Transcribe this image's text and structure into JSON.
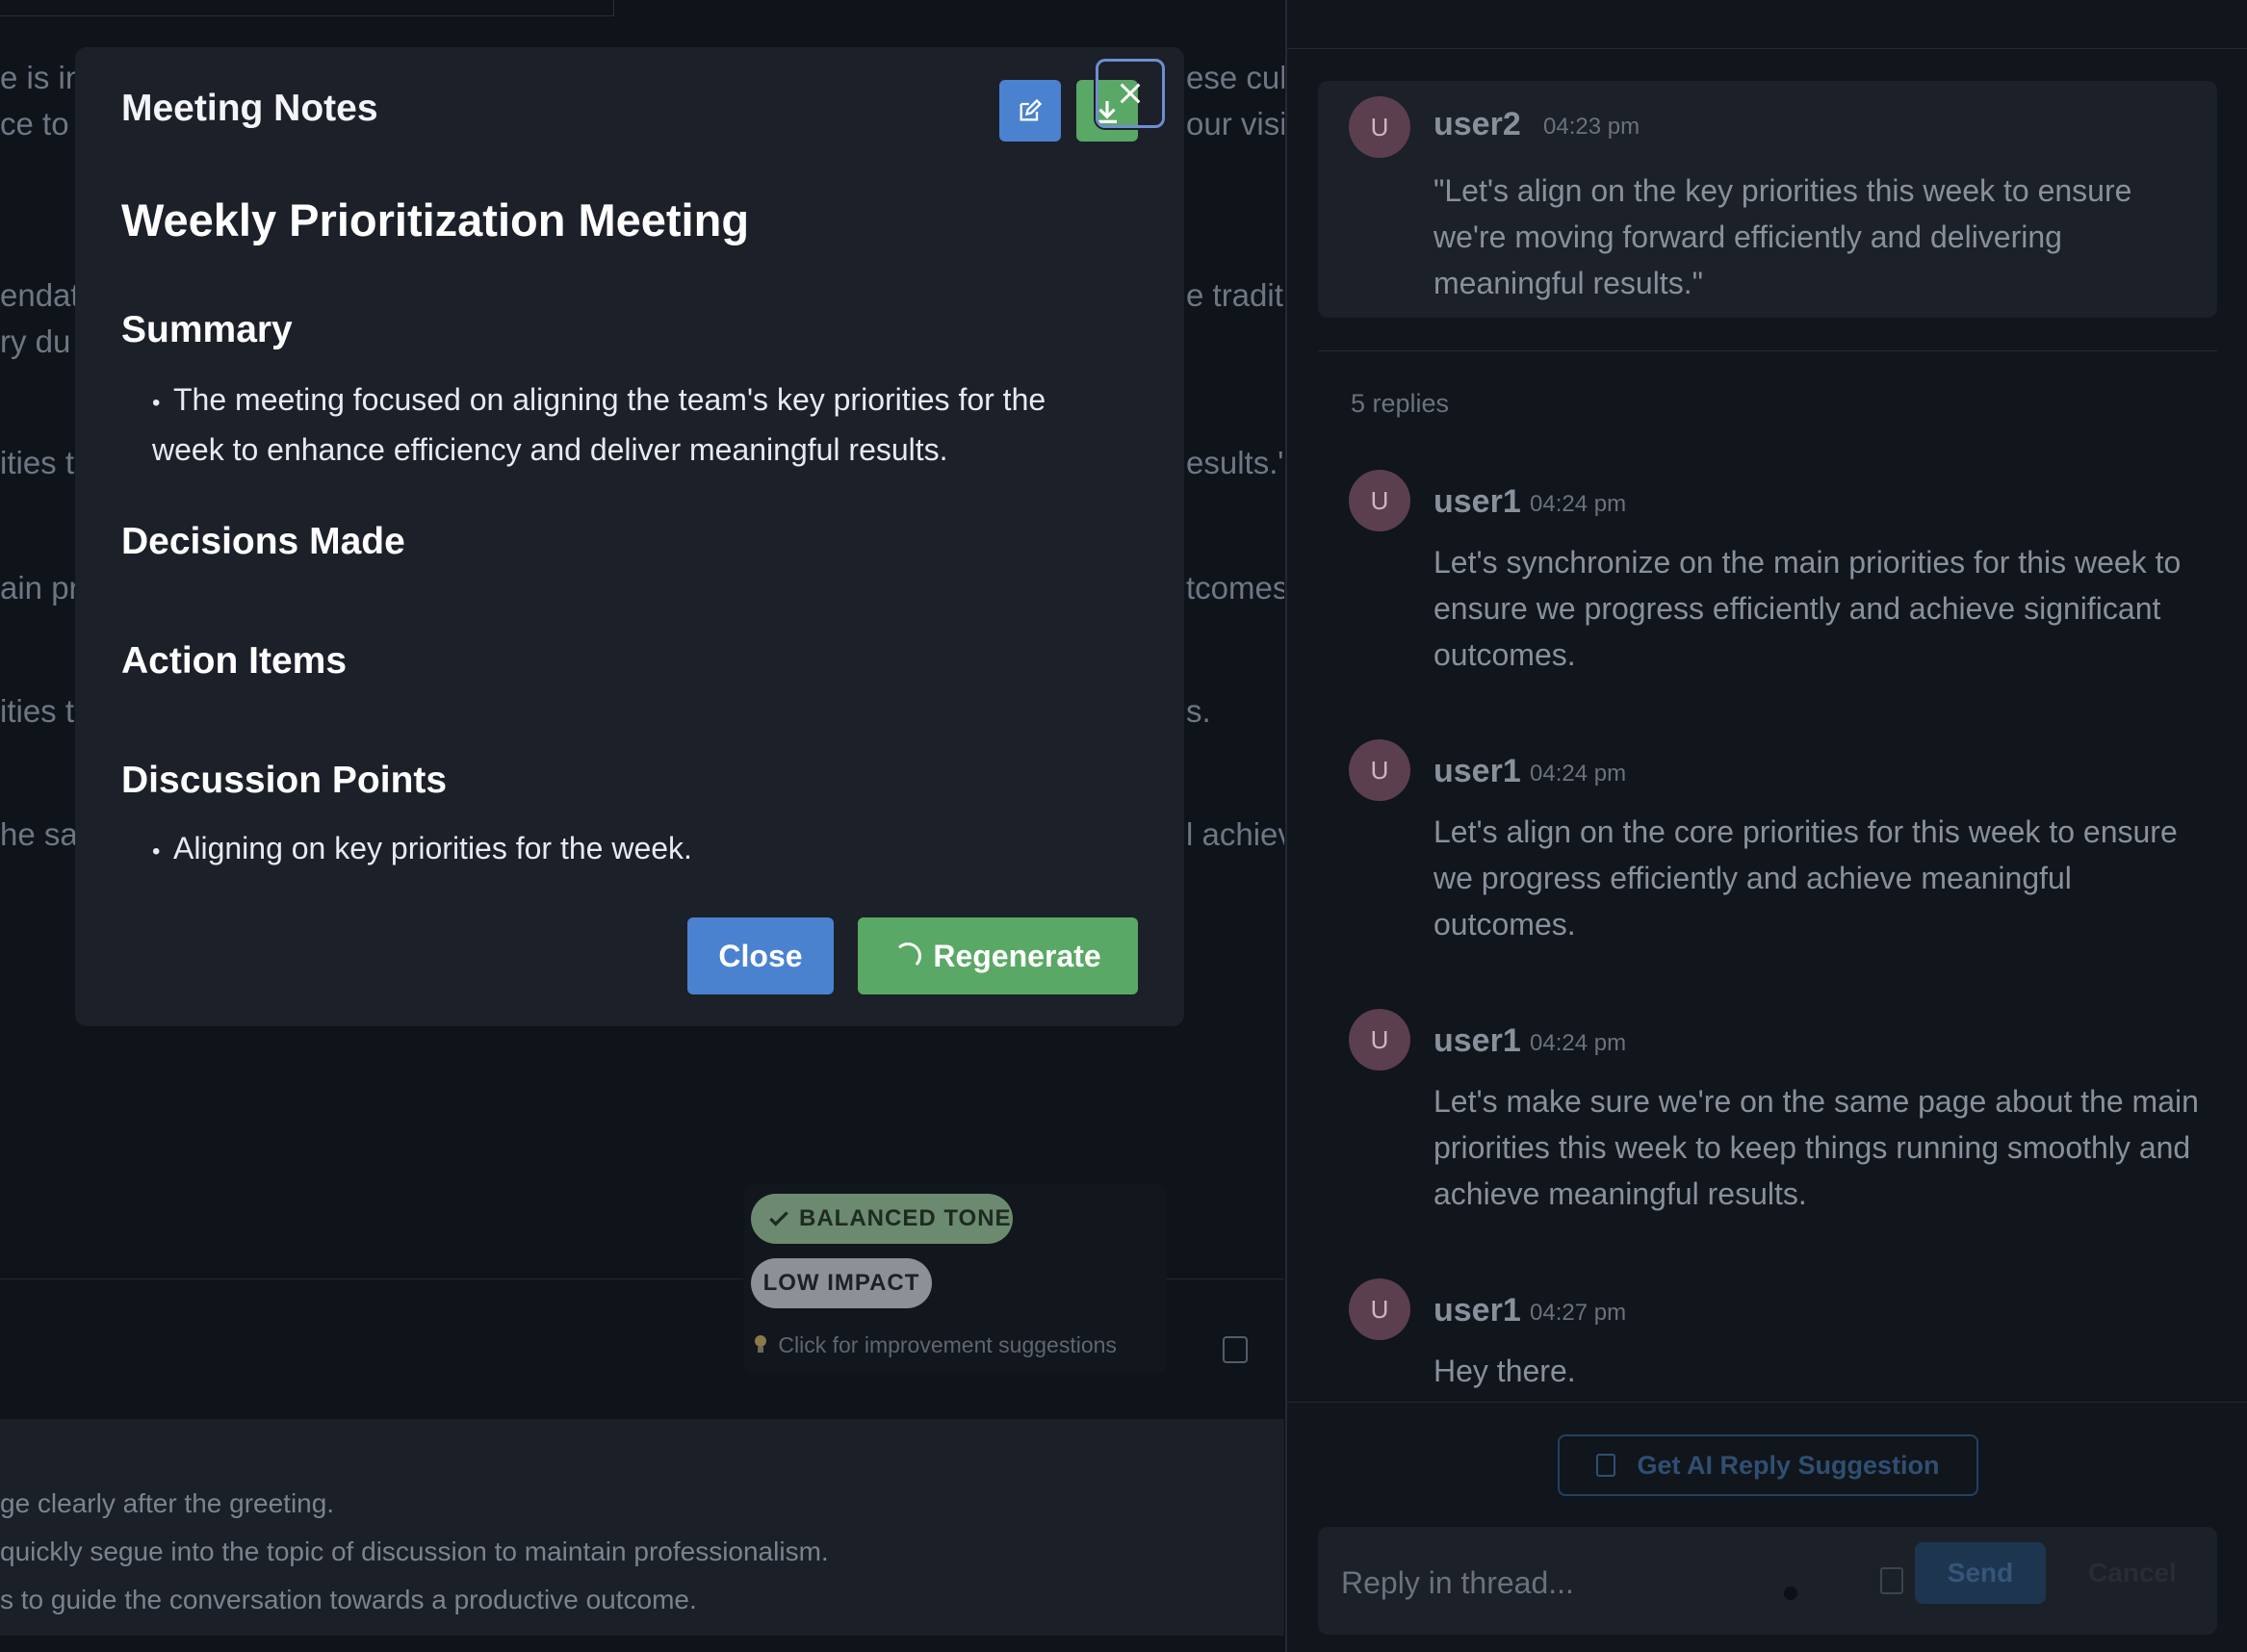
{
  "background": {
    "fragments": [
      "e is in",
      "ce to",
      "endati",
      "ry du",
      "ities t",
      "ain pr",
      "ities t",
      "he sar",
      "ese cul",
      "our visit",
      "e tradit",
      "esults.\"",
      "tcomes",
      "s.",
      "l achiev"
    ],
    "bottom_lines": [
      "ge clearly after the greeting.",
      "quickly segue into the topic of discussion to maintain professionalism.",
      "s to guide the conversation towards a productive outcome."
    ]
  },
  "tone": {
    "balanced_label": "BALANCED TONE",
    "low_label": "LOW IMPACT",
    "hint": "Click for improvement suggestions"
  },
  "modal": {
    "title": "Meeting Notes",
    "heading": "Weekly Prioritization Meeting",
    "summary_title": "Summary",
    "summary_items": [
      "The meeting focused on aligning the team's key priorities for the week to enhance efficiency and deliver meaningful results."
    ],
    "decisions_title": "Decisions Made",
    "actions_title": "Action Items",
    "discussion_title": "Discussion Points",
    "discussion_items": [
      "Aligning on key priorities for the week."
    ],
    "close_label": "Close",
    "regenerate_label": "Regenerate"
  },
  "thread": {
    "parent": {
      "avatar": "U",
      "user": "user2",
      "time": "04:23 pm",
      "text": "\"Let's align on the key priorities this week to ensure we're moving forward efficiently and delivering meaningful results.\""
    },
    "replies_count": "5 replies",
    "replies": [
      {
        "avatar": "U",
        "user": "user1",
        "time": "04:24 pm",
        "text": "Let's synchronize on the main priorities for this week to ensure we progress efficiently and achieve significant outcomes."
      },
      {
        "avatar": "U",
        "user": "user1",
        "time": "04:24 pm",
        "text": "Let's align on the core priorities for this week to ensure we progress efficiently and achieve meaningful outcomes."
      },
      {
        "avatar": "U",
        "user": "user1",
        "time": "04:24 pm",
        "text": "Let's make sure we're on the same page about the main priorities this week to keep things running smoothly and achieve meaningful results."
      },
      {
        "avatar": "U",
        "user": "user1",
        "time": "04:27 pm",
        "text": "Hey there."
      }
    ],
    "ai_button": "Get AI Reply Suggestion",
    "reply_placeholder": "Reply in thread...",
    "send_label": "Send",
    "cancel_label": "Cancel"
  },
  "colors": {
    "accent_blue": "#4a82d0",
    "accent_green": "#5aa865",
    "avatar": "#5b3f4e"
  }
}
